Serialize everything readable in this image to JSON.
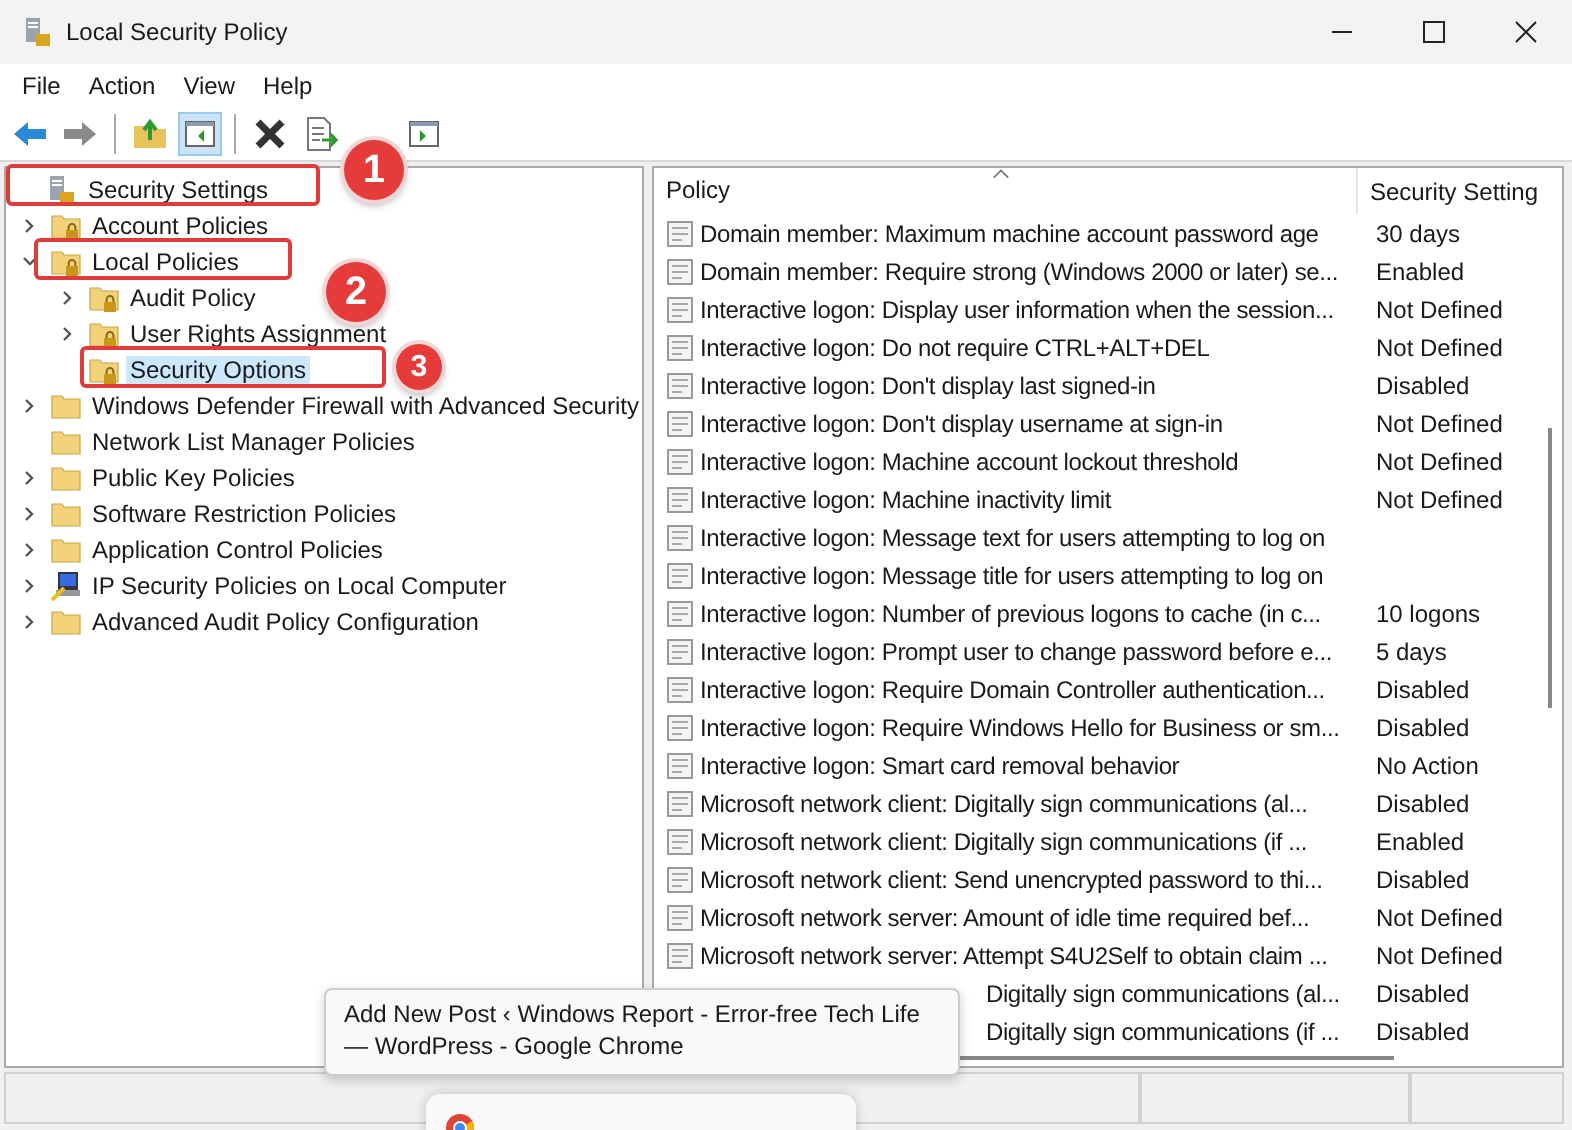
{
  "window": {
    "title": "Local Security Policy"
  },
  "menu": [
    "File",
    "Action",
    "View",
    "Help"
  ],
  "toolbar": [
    {
      "kind": "back",
      "disabled": false,
      "selected": false
    },
    {
      "kind": "forward",
      "disabled": true,
      "selected": false
    },
    {
      "kind": "up-folder",
      "disabled": false,
      "selected": false
    },
    {
      "kind": "pane",
      "disabled": false,
      "selected": true
    },
    {
      "kind": "delete",
      "disabled": false,
      "selected": false
    },
    {
      "kind": "export",
      "disabled": false,
      "selected": false
    },
    {
      "kind": "pane-alt",
      "disabled": false,
      "selected": false
    }
  ],
  "tree": [
    {
      "label": "Security Settings",
      "kind": "root",
      "selected": false,
      "children": [
        {
          "label": "Account Policies",
          "kind": "lock-folder",
          "expandable": true,
          "expanded": false,
          "selected": false
        },
        {
          "label": "Local Policies",
          "kind": "lock-folder",
          "expandable": true,
          "expanded": true,
          "selected": false,
          "children": [
            {
              "label": "Audit Policy",
              "kind": "lock-folder",
              "expandable": true,
              "expanded": false,
              "selected": false
            },
            {
              "label": "User Rights Assignment",
              "kind": "lock-folder",
              "expandable": true,
              "expanded": false,
              "selected": false
            },
            {
              "label": "Security Options",
              "kind": "lock-folder",
              "expandable": false,
              "selected": true
            }
          ]
        },
        {
          "label": "Windows Defender Firewall with Advanced Security",
          "kind": "folder",
          "expandable": true,
          "expanded": false,
          "selected": false
        },
        {
          "label": "Network List Manager Policies",
          "kind": "folder",
          "expandable": false,
          "selected": false
        },
        {
          "label": "Public Key Policies",
          "kind": "folder",
          "expandable": true,
          "expanded": false,
          "selected": false
        },
        {
          "label": "Software Restriction Policies",
          "kind": "folder",
          "expandable": true,
          "expanded": false,
          "selected": false
        },
        {
          "label": "Application Control Policies",
          "kind": "folder",
          "expandable": true,
          "expanded": false,
          "selected": false
        },
        {
          "label": "IP Security Policies on Local Computer",
          "kind": "computer",
          "expandable": true,
          "expanded": false,
          "selected": false
        },
        {
          "label": "Advanced Audit Policy Configuration",
          "kind": "folder",
          "expandable": true,
          "expanded": false,
          "selected": false
        }
      ]
    }
  ],
  "table": {
    "columns": [
      "Policy",
      "Security Setting"
    ],
    "rows": [
      {
        "kind": "policy",
        "policy": "Domain member: Maximum machine account password age",
        "setting": "30 days"
      },
      {
        "kind": "policy",
        "policy": "Domain member: Require strong (Windows 2000 or later) se...",
        "setting": "Enabled"
      },
      {
        "kind": "policy",
        "policy": "Interactive logon: Display user information when the session...",
        "setting": "Not Defined"
      },
      {
        "kind": "policy",
        "policy": "Interactive logon: Do not require CTRL+ALT+DEL",
        "setting": "Not Defined"
      },
      {
        "kind": "policy",
        "policy": "Interactive logon: Don't display last signed-in",
        "setting": "Disabled"
      },
      {
        "kind": "policy",
        "policy": "Interactive logon: Don't display username at sign-in",
        "setting": "Not Defined"
      },
      {
        "kind": "policy",
        "policy": "Interactive logon: Machine account lockout threshold",
        "setting": "Not Defined"
      },
      {
        "kind": "policy",
        "policy": "Interactive logon: Machine inactivity limit",
        "setting": "Not Defined"
      },
      {
        "kind": "policy",
        "policy": "Interactive logon: Message text for users attempting to log on"
      },
      {
        "kind": "policy",
        "policy": "Interactive logon: Message title for users attempting to log on"
      },
      {
        "kind": "policy",
        "policy": "Interactive logon: Number of previous logons to cache (in c...",
        "setting": "10 logons"
      },
      {
        "kind": "policy",
        "policy": "Interactive logon: Prompt user to change password before e...",
        "setting": "5 days"
      },
      {
        "kind": "policy",
        "policy": "Interactive logon: Require Domain Controller authentication...",
        "setting": "Disabled"
      },
      {
        "kind": "policy",
        "policy": "Interactive logon: Require Windows Hello for Business or sm...",
        "setting": "Disabled"
      },
      {
        "kind": "policy",
        "policy": "Interactive logon: Smart card removal behavior",
        "setting": "No Action"
      },
      {
        "kind": "policy",
        "policy": "Microsoft network client: Digitally sign communications (al...",
        "setting": "Disabled"
      },
      {
        "kind": "policy",
        "policy": "Microsoft network client: Digitally sign communications (if ...",
        "setting": "Enabled"
      },
      {
        "kind": "policy",
        "policy": "Microsoft network client: Send unencrypted password to thi...",
        "setting": "Disabled"
      },
      {
        "kind": "policy",
        "policy": "Microsoft network server: Amount of idle time required bef...",
        "setting": "Not Defined"
      },
      {
        "kind": "policy",
        "policy": "Microsoft network server: Attempt S4U2Self to obtain claim ...",
        "setting": "Not Defined"
      },
      {
        "kind": "partly-hidden",
        "policy": "Digitally sign communications (al...",
        "setting": "Disabled"
      },
      {
        "kind": "partly-hidden",
        "policy": "Digitally sign communications (if ...",
        "setting": "Disabled"
      }
    ]
  },
  "annotations": [
    "1",
    "2",
    "3"
  ],
  "tooltip": {
    "text": "Add New Post ‹ Windows Report - Error-free Tech Life — WordPress - Google Chrome"
  }
}
